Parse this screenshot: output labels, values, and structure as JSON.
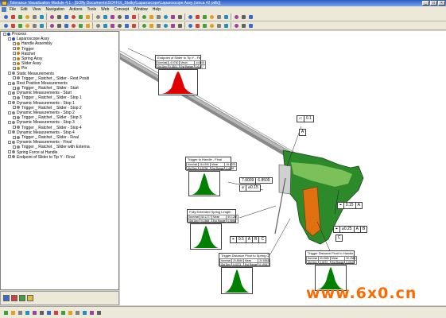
{
  "window": {
    "title": "Tolerance Visualization Module 4.1 - [SOffy Documents\\SOFFIX_Stalky\\Laparoscope\\Laparoscope Assy (xmca 42 pdb)]",
    "controls": {
      "minimize": "_",
      "maximize": "□",
      "close": "×"
    }
  },
  "menu": [
    "File",
    "Edit",
    "View",
    "Navigation",
    "Actions",
    "Tools",
    "Web",
    "Concept",
    "Window",
    "Help"
  ],
  "toolbar1": [
    "save-icon",
    "open-icon",
    "cut-icon",
    "copy-icon",
    "paste-icon",
    "print-icon",
    "undo-icon",
    "redo-icon",
    "select-icon",
    "pan-icon",
    "zoom-icon",
    "rotate-icon",
    "fit-icon",
    "view-front-icon",
    "view-top-icon",
    "view-iso-icon",
    "measure-icon",
    "axis-icon",
    "section-icon",
    "shade-icon",
    "wire-icon",
    "hidden-icon",
    "color-icon",
    "light-icon",
    "grid-icon",
    "snap-icon",
    "layer-icon",
    "filter-icon",
    "stat-icon",
    "report-icon",
    "chart-icon",
    "table-icon",
    "export-icon"
  ],
  "toolbar2": [
    "datum-icon",
    "feature-icon",
    "point-icon",
    "plane-icon",
    "line-icon",
    "circle-icon",
    "cylinder-icon",
    "cone-icon",
    "sphere-icon",
    "slot-icon",
    "tab-icon",
    "pattern-icon",
    "tolerance-icon",
    "position-icon",
    "profile-icon",
    "flatness-icon",
    "parallel-icon",
    "perp-icon",
    "angular-icon",
    "runout-icon",
    "concentric-icon",
    "symmetry-icon",
    "straight-icon",
    "round-icon",
    "assembly-icon",
    "move-icon",
    "constraint-icon",
    "mate-icon",
    "insert-icon",
    "align-icon",
    "measure2-icon",
    "analyze-icon",
    "simulate-icon"
  ],
  "tree": [
    {
      "label": "Process",
      "level": 0,
      "color": "#2050c0"
    },
    {
      "label": "Laparoscope Assy",
      "level": 1,
      "color": "#2050c0"
    },
    {
      "label": "Handle Assembly",
      "level": 2,
      "color": "#c08020"
    },
    {
      "label": "Trigger",
      "level": 2,
      "color": "#c08020"
    },
    {
      "label": "Ratchet",
      "level": 2,
      "color": "#c08020"
    },
    {
      "label": "Spring Assy",
      "level": 2,
      "color": "#c08020"
    },
    {
      "label": "Slider Assy",
      "level": 2,
      "color": "#c08020"
    },
    {
      "label": "Pin",
      "level": 2,
      "color": "#c08020"
    },
    {
      "label": "Static Measurements",
      "level": 1,
      "color": "#808080"
    },
    {
      "label": "Trigger _ Ratchet _ Slider - Rest Positi",
      "level": 2,
      "color": "#808080"
    },
    {
      "label": "Rest Position Measurements",
      "level": 1,
      "color": "#808080"
    },
    {
      "label": "Trigger _ Ratchet _ Slider - Start",
      "level": 2,
      "color": "#808080"
    },
    {
      "label": "Dynamic Measurements - Start",
      "level": 1,
      "color": "#808080"
    },
    {
      "label": "Trigger _ Ratchet _ Slider - Stop 1",
      "level": 2,
      "color": "#808080"
    },
    {
      "label": "Dynamic Measurements - Stop 1",
      "level": 1,
      "color": "#808080"
    },
    {
      "label": "Trigger _ Ratchet _ Slider - Stop 2",
      "level": 2,
      "color": "#808080"
    },
    {
      "label": "Dynamic Measurements - Stop 2",
      "level": 1,
      "color": "#808080"
    },
    {
      "label": "Trigger _ Ratchet _ Slider - Stop 3",
      "level": 2,
      "color": "#808080"
    },
    {
      "label": "Dynamic Measurements - Stop 3",
      "level": 1,
      "color": "#808080"
    },
    {
      "label": "Trigger _ Ratchet _ Slider - Stop 4",
      "level": 2,
      "color": "#808080"
    },
    {
      "label": "Dynamic Measurements - Stop 4",
      "level": 1,
      "color": "#808080"
    },
    {
      "label": "Trigger _ Ratchet _ Slider - Final",
      "level": 2,
      "color": "#808080"
    },
    {
      "label": "Dynamic Measurements - Final",
      "level": 1,
      "color": "#808080"
    },
    {
      "label": "Trigger _ Ratchet _ Slider with Externa",
      "level": 2,
      "color": "#808080"
    },
    {
      "label": "Spring Force at Handle",
      "level": 1,
      "color": "#808080"
    },
    {
      "label": "Endpoint of Slider to Tip Y - Final",
      "level": 1,
      "color": "#808080"
    }
  ],
  "panels": [
    {
      "title": "Endpoint of Slider to Tip Y - Final",
      "rows": [
        [
          "Nominal",
          "-4.0760",
          "Mean",
          "-4.0805"
        ],
        [
          "Std Dev",
          "0.3521",
          "Est Range",
          "1.6167"
        ]
      ],
      "curve_color": "#e00000"
    },
    {
      "title": "Trigger to Handle - Final",
      "rows": [
        [
          "Nominal",
          "16.4250",
          "Mean",
          "16.4378"
        ],
        [
          "Std Dev",
          "0.0798",
          "Est Range",
          "0.4118"
        ]
      ],
      "curve_color": "#008000"
    },
    {
      "title": "Fully Extended Spring Length",
      "rows": [
        [
          "Nominal",
          "50.1277",
          "Mean",
          "50.1282"
        ],
        [
          "Std Dev",
          "0.1868",
          "Est Range",
          "0.9856"
        ]
      ],
      "curve_color": "#008000"
    },
    {
      "title": "Trigger Distance Pivot to Spring Clip",
      "rows": [
        [
          "Nominal",
          "20.8556",
          "Mean",
          "20.8552"
        ],
        [
          "Std Dev",
          "0.0373",
          "Est Range",
          "0.1926"
        ]
      ],
      "curve_color": "#008000"
    },
    {
      "title": "Trigger Distance Pivot to Handle",
      "rows": [
        [
          "Nominal",
          "30.2580",
          "Mean",
          "30.2582"
        ],
        [
          "Std Dev",
          "0.0072",
          "Est Range",
          "0.0547"
        ]
      ],
      "curve_color": "#008000"
    }
  ],
  "fcf": {
    "flatness": {
      "sym": "▱",
      "value": "0.1"
    },
    "dims": {
      "upper": "7.9009",
      "lower": "6.8509"
    },
    "dia_a": {
      "sym": "⌀",
      "value": "⌀0.15"
    },
    "pos_a": {
      "sym": "⌖",
      "value": "0.15",
      "ref": "A"
    },
    "pos_ab": {
      "sym": "⌖",
      "value": "⌀0.25",
      "ref1": "A",
      "ref2": "B"
    },
    "pos_abc": {
      "sym": "⌖",
      "value": "0.5",
      "ref1": "A",
      "ref2": "B",
      "ref3": "C"
    },
    "datum_a": "A",
    "datum_c": "C"
  },
  "watermark": "www.6x0.cn",
  "colors": {
    "handle": "#3a8a30",
    "slider": "#e07010",
    "shaft": "#b0b0b0",
    "accent": "#2a5bc8"
  }
}
